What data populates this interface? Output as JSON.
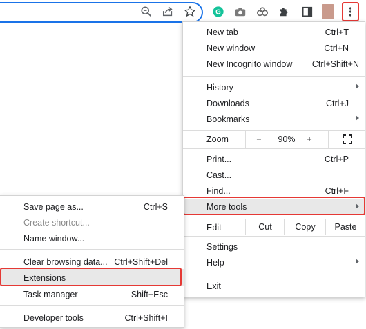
{
  "toolbar": {
    "icons": [
      "zoom-icon",
      "share-icon",
      "bookmark-star-icon",
      "grammarly-icon",
      "camera-icon",
      "link-extension-icon",
      "puzzle-extensions-icon",
      "side-panel-icon",
      "profile-avatar",
      "kebab-menu-icon"
    ],
    "accent": "#1a73e8",
    "highlight": "#e53935",
    "grammarly_color": "#15c39a"
  },
  "menu": {
    "new_tab": {
      "label": "New tab",
      "shortcut": "Ctrl+T"
    },
    "new_window": {
      "label": "New window",
      "shortcut": "Ctrl+N"
    },
    "new_incognito": {
      "label": "New Incognito window",
      "shortcut": "Ctrl+Shift+N"
    },
    "history": {
      "label": "History"
    },
    "downloads": {
      "label": "Downloads",
      "shortcut": "Ctrl+J"
    },
    "bookmarks": {
      "label": "Bookmarks"
    },
    "zoom": {
      "label": "Zoom",
      "minus": "−",
      "value": "90%",
      "plus": "+"
    },
    "print": {
      "label": "Print...",
      "shortcut": "Ctrl+P"
    },
    "cast": {
      "label": "Cast..."
    },
    "find": {
      "label": "Find...",
      "shortcut": "Ctrl+F"
    },
    "more_tools": {
      "label": "More tools"
    },
    "edit": {
      "label": "Edit",
      "cut": "Cut",
      "copy": "Copy",
      "paste": "Paste"
    },
    "settings": {
      "label": "Settings"
    },
    "help": {
      "label": "Help"
    },
    "exit": {
      "label": "Exit"
    }
  },
  "submenu": {
    "save_page": {
      "label": "Save page as...",
      "shortcut": "Ctrl+S"
    },
    "create_shortcut": {
      "label": "Create shortcut..."
    },
    "name_window": {
      "label": "Name window..."
    },
    "clear_browsing": {
      "label": "Clear browsing data...",
      "shortcut": "Ctrl+Shift+Del"
    },
    "extensions": {
      "label": "Extensions"
    },
    "task_manager": {
      "label": "Task manager",
      "shortcut": "Shift+Esc"
    },
    "developer_tools": {
      "label": "Developer tools",
      "shortcut": "Ctrl+Shift+I"
    }
  }
}
